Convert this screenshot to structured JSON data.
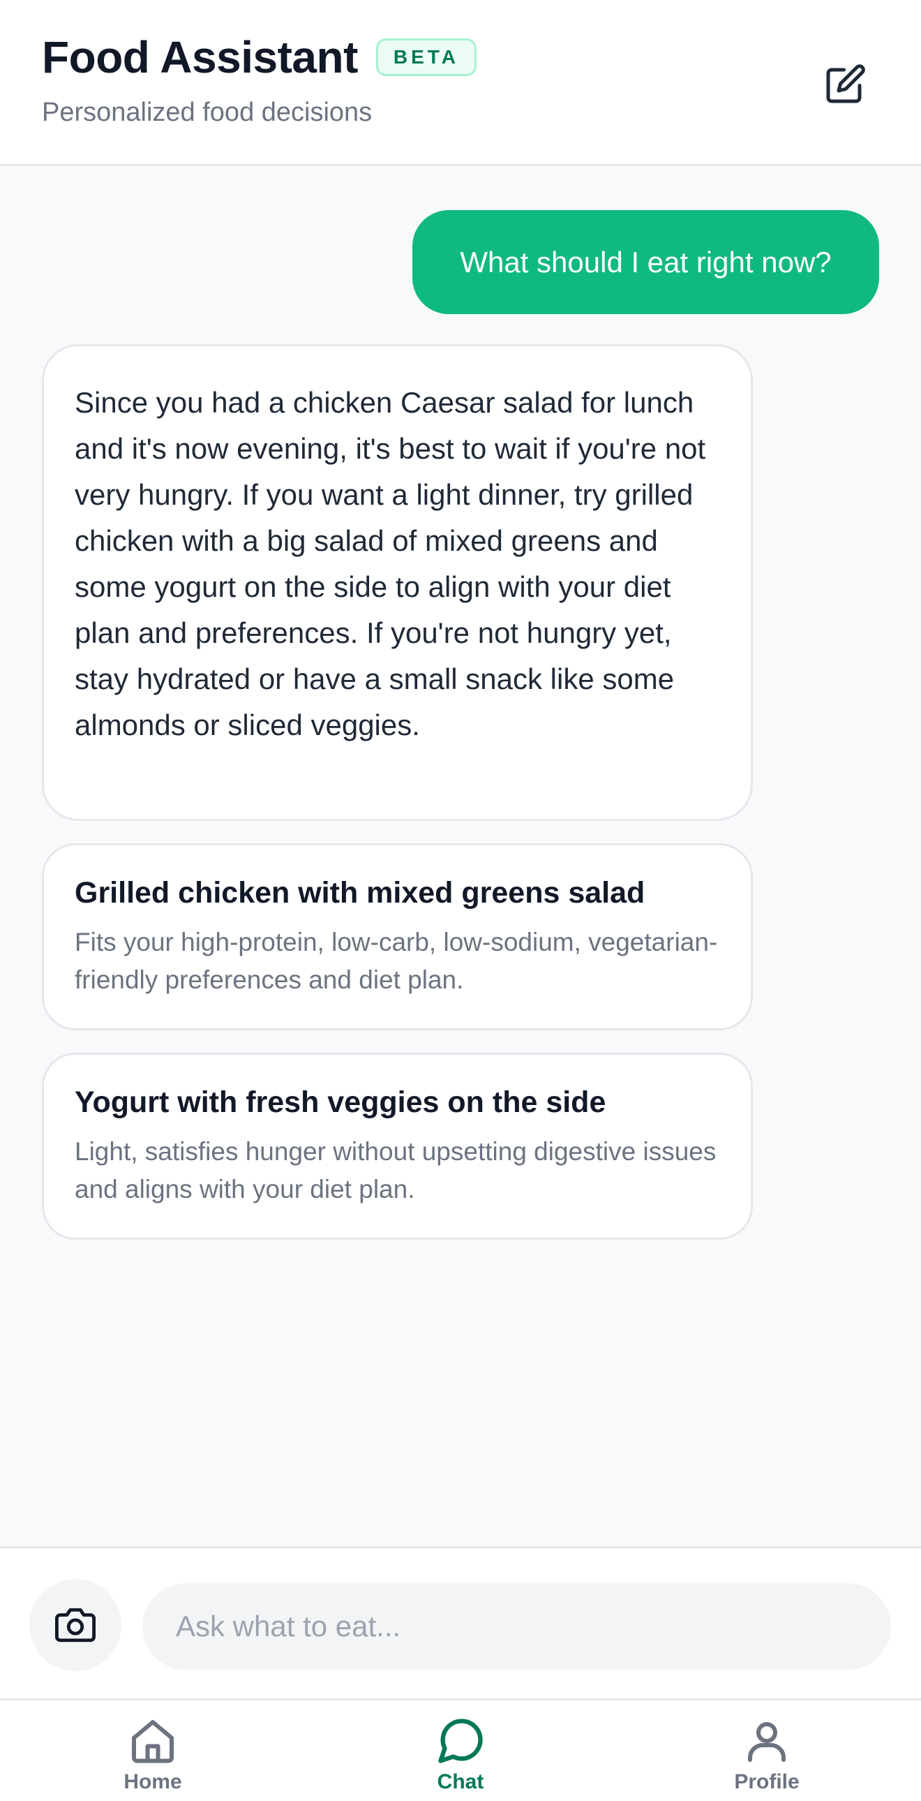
{
  "header": {
    "title": "Food Assistant",
    "badge": "BETA",
    "subtitle": "Personalized food decisions",
    "edit_icon": "edit-icon"
  },
  "chat": {
    "user_message": "What should I eat right now?",
    "assistant_message": "Since you had a chicken Caesar salad for lunch and it's now evening, it's best to wait if you're not very hungry. If you want a light dinner, try grilled chicken with a big salad of mixed greens and some yogurt on the side to align with your diet plan and preferences. If you're not hungry yet, stay hydrated or have a small snack like some almonds or sliced veggies.",
    "suggestions": [
      {
        "title": "Grilled chicken with mixed greens salad",
        "description": "Fits your high-protein, low-carb, low-sodium, vegetarian-friendly preferences and diet plan."
      },
      {
        "title": "Yogurt with fresh veggies on the side",
        "description": "Light, satisfies hunger without upsetting digestive issues and aligns with your diet plan."
      }
    ]
  },
  "composer": {
    "camera_icon": "camera-icon",
    "placeholder": "Ask what to eat..."
  },
  "nav": {
    "items": [
      {
        "label": "Home",
        "icon": "home-icon",
        "active": false
      },
      {
        "label": "Chat",
        "icon": "chat-bubble-icon",
        "active": true
      },
      {
        "label": "Profile",
        "icon": "user-icon",
        "active": false
      }
    ]
  },
  "colors": {
    "accent": "#10b981",
    "accent_dark": "#047857",
    "badge_bg": "#ecfdf5",
    "badge_border": "#a7f3d0",
    "background": "#f8f9fb",
    "muted_text": "#6b7280"
  }
}
